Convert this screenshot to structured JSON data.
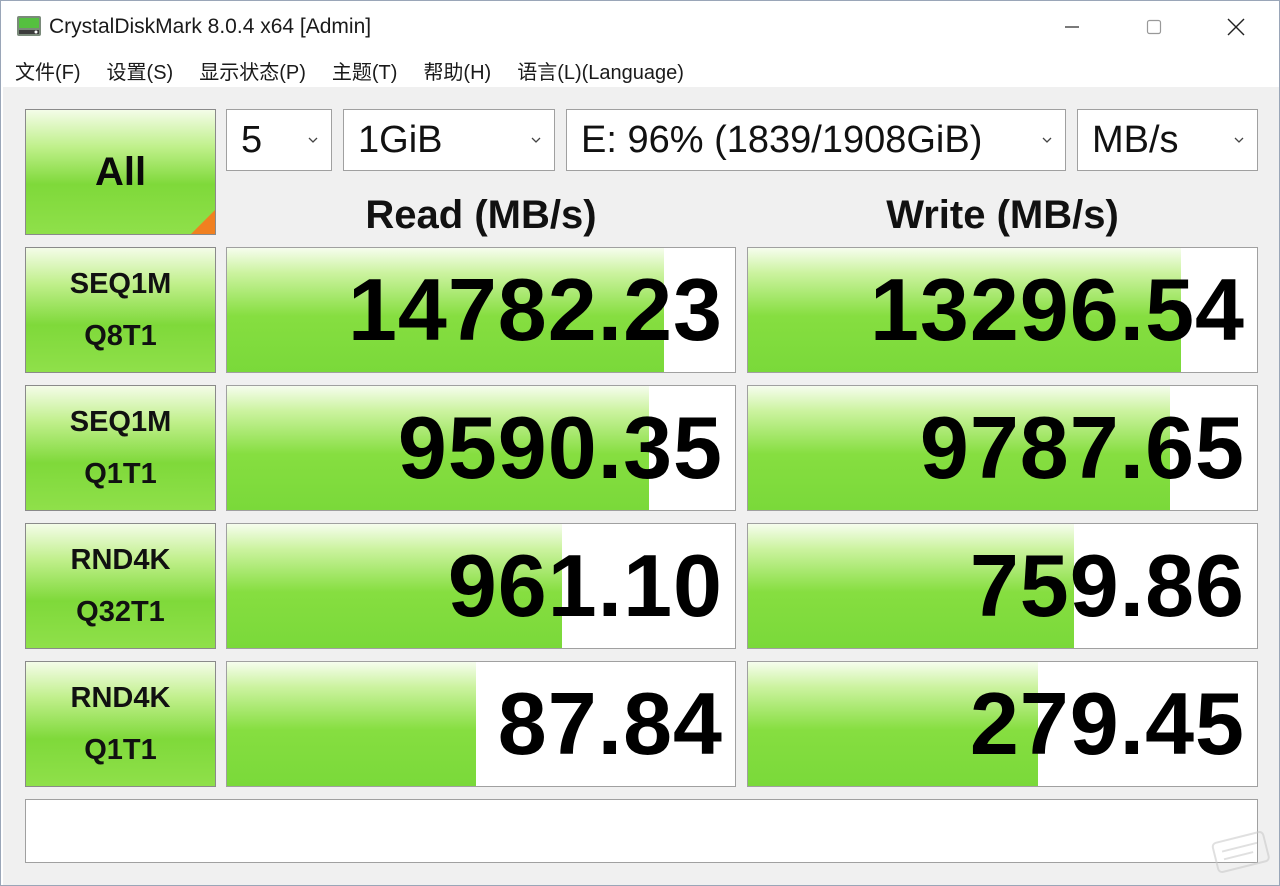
{
  "window": {
    "title": "CrystalDiskMark 8.0.4 x64 [Admin]"
  },
  "menu": [
    {
      "label": "文件(F)"
    },
    {
      "label": "设置(S)"
    },
    {
      "label": "显示状态(P)"
    },
    {
      "label": "主题(T)"
    },
    {
      "label": "帮助(H)"
    },
    {
      "label": "语言(L)(Language)"
    }
  ],
  "controls": {
    "all_label": "All",
    "count_value": "5",
    "size_value": "1GiB",
    "drive_value": "E: 96% (1839/1908GiB)",
    "unit_value": "MB/s"
  },
  "headers": {
    "read": "Read (MB/s)",
    "write": "Write (MB/s)"
  },
  "tests": [
    {
      "line1": "SEQ1M",
      "line2": "Q8T1",
      "read": "14782.23",
      "write": "13296.54",
      "read_fill": 0.86,
      "write_fill": 0.85
    },
    {
      "line1": "SEQ1M",
      "line2": "Q1T1",
      "read": "9590.35",
      "write": "9787.65",
      "read_fill": 0.83,
      "write_fill": 0.83
    },
    {
      "line1": "RND4K",
      "line2": "Q32T1",
      "read": "961.10",
      "write": "759.86",
      "read_fill": 0.66,
      "write_fill": 0.64
    },
    {
      "line1": "RND4K",
      "line2": "Q1T1",
      "read": "87.84",
      "write": "279.45",
      "read_fill": 0.49,
      "write_fill": 0.57
    }
  ],
  "comment": "",
  "colors": {
    "accent_green": "#7fd93a",
    "corner_orange": "#f08020"
  }
}
